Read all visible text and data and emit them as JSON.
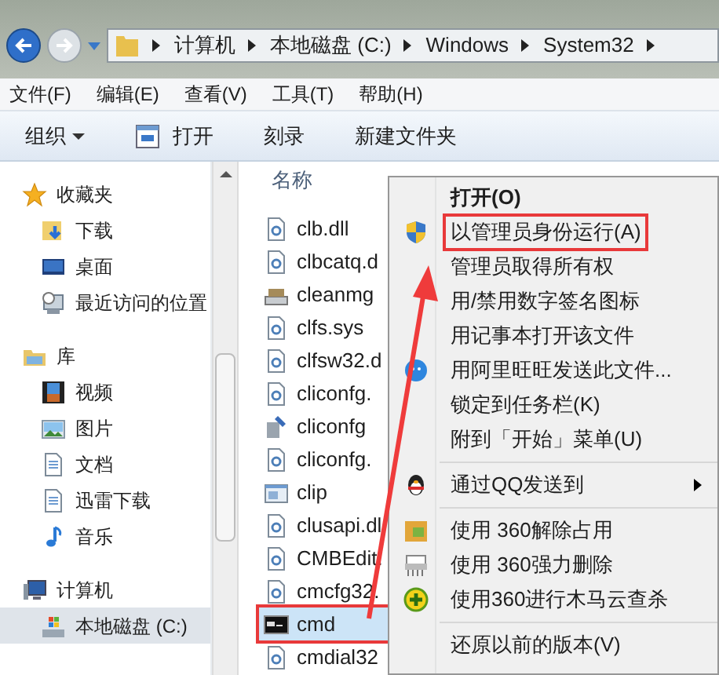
{
  "address_bar": {
    "crumbs": [
      "计算机",
      "本地磁盘 (C:)",
      "Windows",
      "System32"
    ]
  },
  "menu_bar": [
    "文件(F)",
    "编辑(E)",
    "查看(V)",
    "工具(T)",
    "帮助(H)"
  ],
  "toolbar": [
    {
      "label": "组织",
      "kind": "dropdown"
    },
    {
      "label": "打开",
      "kind": "icon"
    },
    {
      "label": "刻录",
      "kind": "plain"
    },
    {
      "label": "新建文件夹",
      "kind": "plain"
    }
  ],
  "nav_tree": [
    {
      "label": "收藏夹",
      "selected": false,
      "children": [
        {
          "label": "下载",
          "selected": false
        },
        {
          "label": "桌面",
          "selected": false
        },
        {
          "label": "最近访问的位置",
          "selected": false
        }
      ]
    },
    {
      "label": "库",
      "selected": false,
      "children": [
        {
          "label": "视频",
          "selected": false
        },
        {
          "label": "图片",
          "selected": false
        },
        {
          "label": "文档",
          "selected": false
        },
        {
          "label": "迅雷下载",
          "selected": false
        },
        {
          "label": "音乐",
          "selected": false
        }
      ]
    },
    {
      "label": "计算机",
      "selected": false,
      "children": [
        {
          "label": "本地磁盘 (C:)",
          "selected": true
        }
      ]
    }
  ],
  "file_list": {
    "column": "名称",
    "files": [
      {
        "name": "clb.dll",
        "kind": "dll",
        "selected": false,
        "annotated": false
      },
      {
        "name": "clbcatq.d",
        "kind": "dll",
        "selected": false,
        "annotated": false
      },
      {
        "name": "cleanmg",
        "kind": "drive",
        "selected": false,
        "annotated": false
      },
      {
        "name": "clfs.sys",
        "kind": "dll",
        "selected": false,
        "annotated": false
      },
      {
        "name": "clfsw32.d",
        "kind": "dll",
        "selected": false,
        "annotated": false
      },
      {
        "name": "cliconfg.",
        "kind": "dll",
        "selected": false,
        "annotated": false
      },
      {
        "name": "cliconfg",
        "kind": "tool",
        "selected": false,
        "annotated": false
      },
      {
        "name": "cliconfg.",
        "kind": "dll",
        "selected": false,
        "annotated": false
      },
      {
        "name": "clip",
        "kind": "window",
        "selected": false,
        "annotated": false
      },
      {
        "name": "clusapi.dl",
        "kind": "dll",
        "selected": false,
        "annotated": false
      },
      {
        "name": "CMBEdit.",
        "kind": "dll",
        "selected": false,
        "annotated": false
      },
      {
        "name": "cmcfg32.",
        "kind": "dll",
        "selected": false,
        "annotated": false
      },
      {
        "name": "cmd",
        "kind": "console",
        "selected": true,
        "annotated": true
      },
      {
        "name": "cmdial32",
        "kind": "dll",
        "selected": false,
        "annotated": false
      }
    ]
  },
  "context_menu": [
    {
      "kind": "plain",
      "label": "打开(O)",
      "bold": true,
      "annotated": false
    },
    {
      "kind": "shield",
      "label": "以管理员身份运行(A)",
      "bold": false,
      "annotated": true
    },
    {
      "kind": "plain",
      "label": "管理员取得所有权",
      "bold": false,
      "annotated": false
    },
    {
      "kind": "plain",
      "label": "用/禁用数字签名图标",
      "bold": false,
      "annotated": false
    },
    {
      "kind": "plain",
      "label": "用记事本打开该文件",
      "bold": false,
      "annotated": false
    },
    {
      "kind": "bubble",
      "label": "用阿里旺旺发送此文件...",
      "bold": false,
      "annotated": false
    },
    {
      "kind": "plain",
      "label": "锁定到任务栏(K)",
      "bold": false,
      "annotated": false
    },
    {
      "kind": "plain",
      "label": "附到「开始」菜单(U)",
      "bold": false,
      "annotated": false
    },
    {
      "kind": "separator"
    },
    {
      "kind": "penguin",
      "label": "通过QQ发送到",
      "bold": false,
      "annotated": false,
      "submenu": true
    },
    {
      "kind": "separator"
    },
    {
      "kind": "folder",
      "label": "使用 360解除占用",
      "bold": false,
      "annotated": false
    },
    {
      "kind": "shredder",
      "label": "使用 360强力删除",
      "bold": false,
      "annotated": false
    },
    {
      "kind": "plus",
      "label": "使用360进行木马云查杀",
      "bold": false,
      "annotated": false
    },
    {
      "kind": "separator"
    },
    {
      "kind": "plain",
      "label": "还原以前的版本(V)",
      "bold": false,
      "annotated": false
    }
  ]
}
